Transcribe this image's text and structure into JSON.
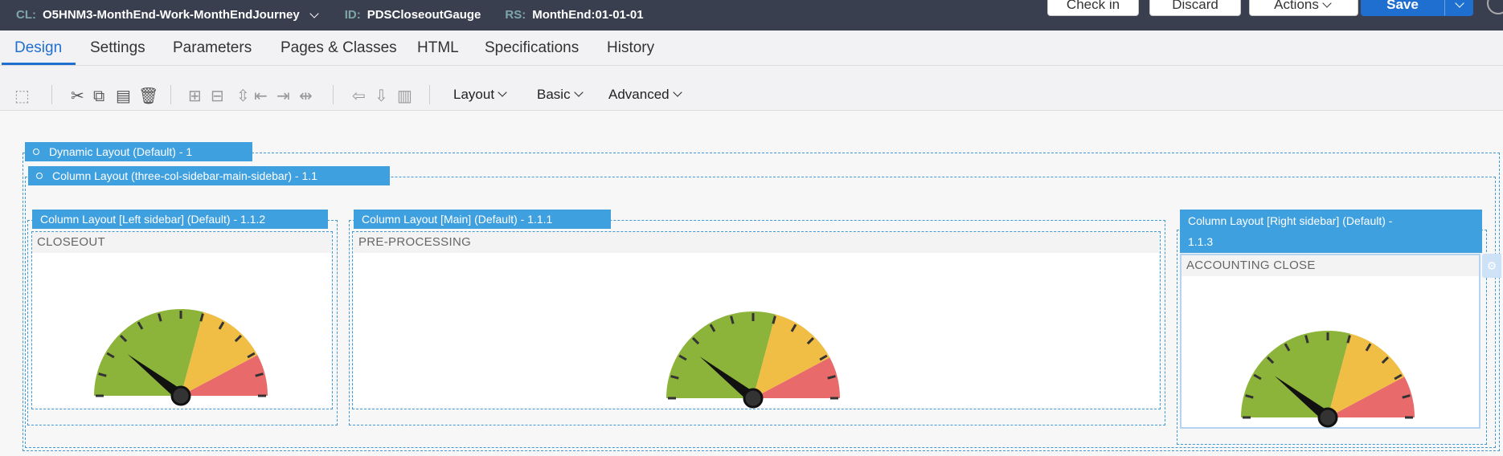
{
  "header": {
    "cl_key": "CL:",
    "cl_value": "O5HNM3-MonthEnd-Work-MonthEndJourney",
    "id_key": "ID:",
    "id_value": "PDSCloseoutGauge",
    "rs_key": "RS:",
    "rs_value": "MonthEnd:01-01-01",
    "buttons": {
      "check_in": "Check in",
      "discard": "Discard",
      "actions": "Actions",
      "save": "Save"
    }
  },
  "tabs": [
    "Design",
    "Settings",
    "Parameters",
    "Pages & Classes",
    "HTML",
    "Specifications",
    "History"
  ],
  "active_tab": "Design",
  "toolbar": {
    "layout": "Layout",
    "basic": "Basic",
    "advanced": "Advanced"
  },
  "canvas": {
    "dynamic_layout": "Dynamic Layout (Default) -    1",
    "column_layout": "Column Layout (three-col-sidebar-main-sidebar) -    1.1",
    "left_label": "Column Layout [Left sidebar] (Default) -    1.1.2",
    "main_label": "Column Layout [Main] (Default) -    1.1.1",
    "right_label": "Column Layout [Right sidebar] (Default) -",
    "right_label_id": "1.1.3",
    "left_section": "CLOSEOUT",
    "main_section": "PRE-PROCESSING",
    "right_section": "ACCOUNTING CLOSE"
  },
  "colors": {
    "header_bg": "#3a3f4f",
    "accent": "#1f6fd1",
    "layout_label": "#3fa0e0",
    "gauge_green": "#8cb33a",
    "gauge_yellow": "#f0bd45",
    "gauge_red": "#e86a6a"
  },
  "icons": [
    "section-icon",
    "cut-icon",
    "copy-icon",
    "paste-icon",
    "delete-icon",
    "insert-row-icon",
    "insert-column-icon",
    "move-icon",
    "add-left-icon",
    "add-right-icon",
    "split-icon",
    "arrow-left-icon",
    "arrow-down-icon",
    "columns-icon"
  ]
}
